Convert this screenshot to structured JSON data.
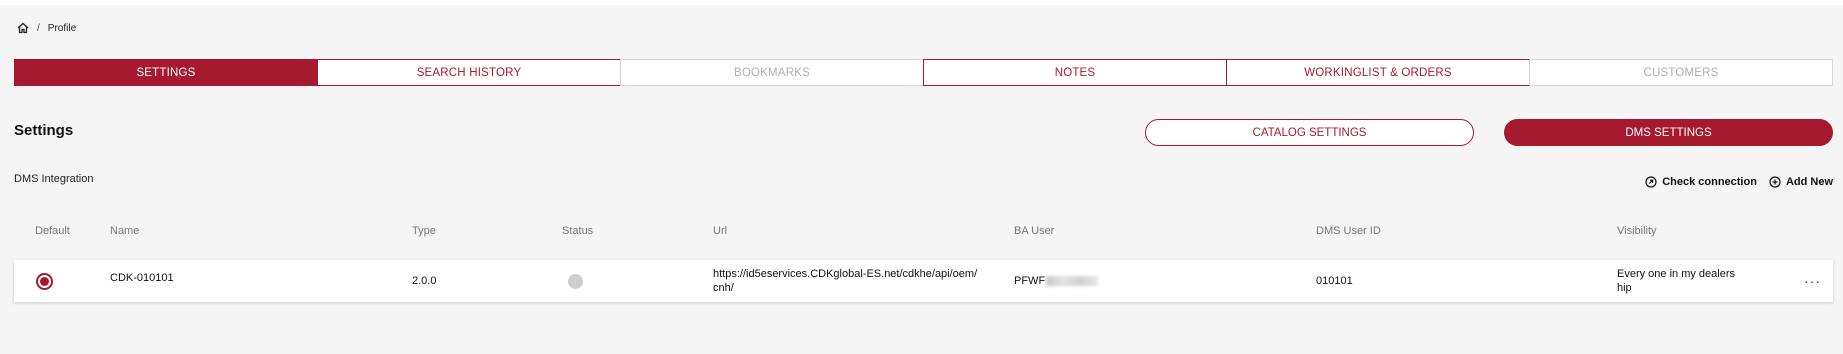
{
  "breadcrumb": {
    "current": "Profile",
    "separator": "/"
  },
  "tabs": [
    {
      "label": "SETTINGS",
      "state": "active"
    },
    {
      "label": "SEARCH HISTORY",
      "state": "enabled"
    },
    {
      "label": "BOOKMARKS",
      "state": "disabled"
    },
    {
      "label": "NOTES",
      "state": "enabled"
    },
    {
      "label": "WORKINGLIST & ORDERS",
      "state": "enabled"
    },
    {
      "label": "CUSTOMERS",
      "state": "disabled"
    }
  ],
  "settings": {
    "title": "Settings",
    "catalog_button": "CATALOG SETTINGS",
    "dms_button": "DMS SETTINGS"
  },
  "dms": {
    "title": "DMS Integration",
    "check_connection": "Check connection",
    "add_new": "Add New"
  },
  "table": {
    "headers": {
      "default": "Default",
      "name": "Name",
      "type": "Type",
      "status": "Status",
      "url": "Url",
      "ba_user": "BA User",
      "dms_user_id": "DMS User ID",
      "visibility": "Visibility"
    },
    "rows": [
      {
        "default": true,
        "name": "CDK-010101",
        "type": "2.0.0",
        "status": "inactive",
        "url_line1": "https://id5eservices.CDKglobal-ES.net/cdkhe/api/oem/",
        "url_line2": "cnh/",
        "ba_user_prefix": "PFWF",
        "dms_user_id": "010101",
        "visibility_line1": "Every one in my dealers",
        "visibility_line2": "hip",
        "more": "···"
      }
    ]
  },
  "colors": {
    "brand": "#a61a30",
    "disabled": "#b0b0b0",
    "background": "#f5f5f5"
  },
  "icons": {
    "home": "home-icon",
    "check": "check-connection-icon",
    "add": "add-circle-icon"
  }
}
